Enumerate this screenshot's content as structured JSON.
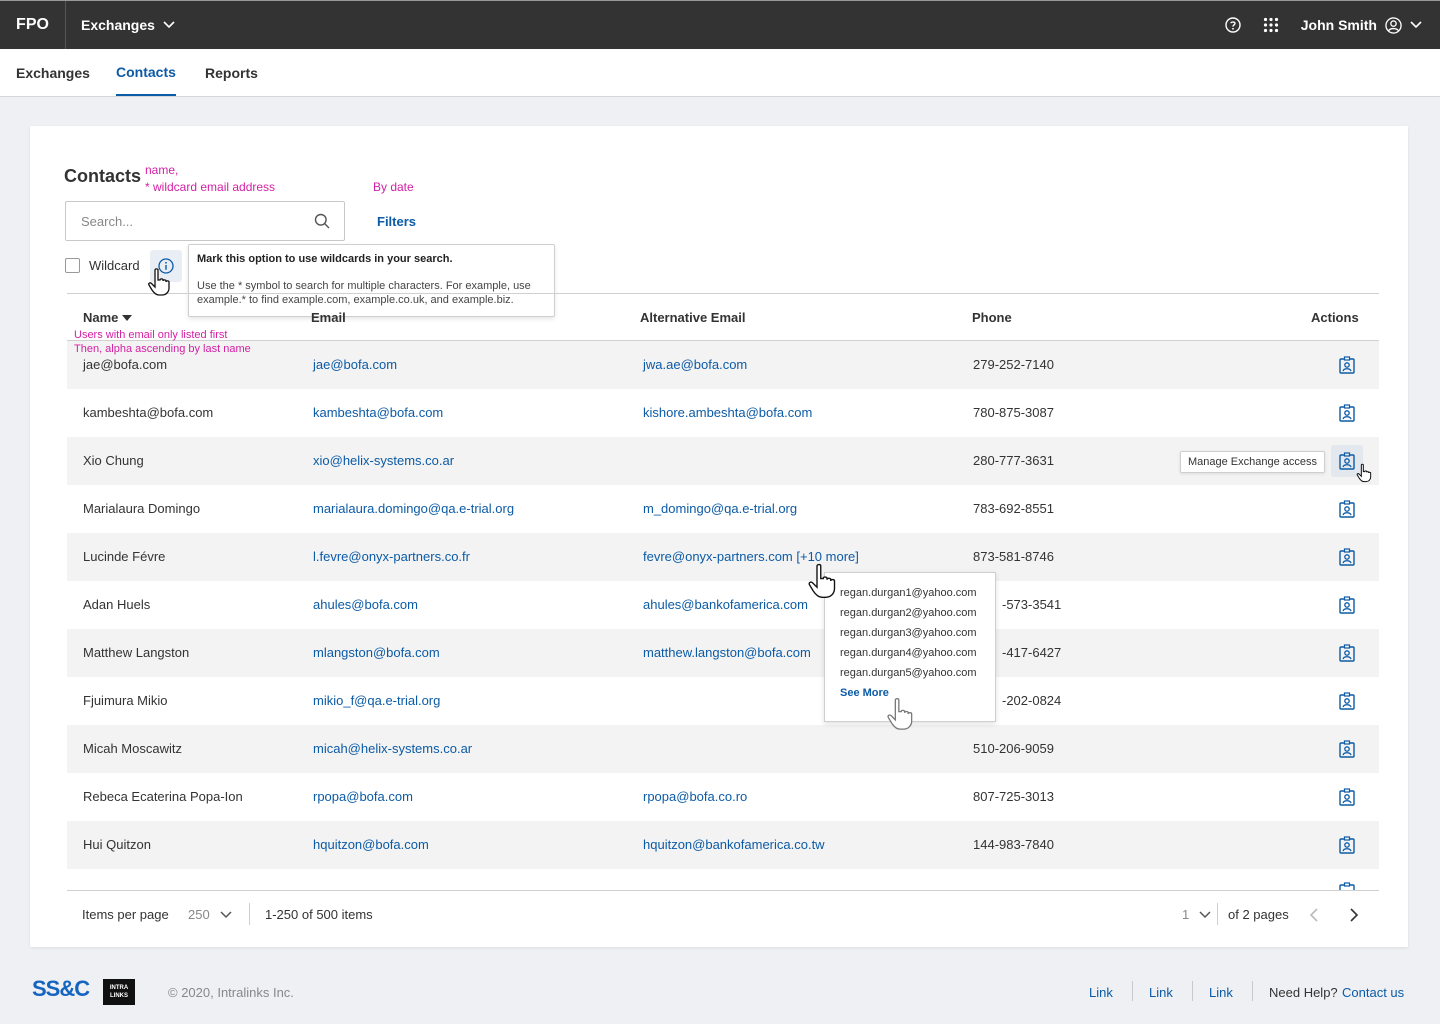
{
  "header": {
    "brand": "FPO",
    "app_selector": "Exchanges",
    "user_name": "John Smith",
    "icons": [
      "help-icon",
      "apps-grid-icon",
      "user-circle-icon",
      "chevron-down-icon"
    ]
  },
  "tabs": [
    {
      "label": "Exchanges",
      "active": false
    },
    {
      "label": "Contacts",
      "active": true
    },
    {
      "label": "Reports",
      "active": false
    }
  ],
  "contacts": {
    "title": "Contacts",
    "annotation_search_line1": "name,",
    "annotation_search_line2": "* wildcard email address",
    "annotation_filter": "By date",
    "search_placeholder": "Search...",
    "filters_label": "Filters",
    "wildcard_label": "Wildcard",
    "wildcard_checked": false,
    "tooltip_title": "Mark this option to use wildcards in your search.",
    "tooltip_body": "Use the * symbol to search for multiple characters. For example, use example.* to find example.com, example.co.uk, and example.biz.",
    "annotation_sort_line1": "Users with email only listed first",
    "annotation_sort_line2": "Then, alpha ascending by last name"
  },
  "table": {
    "columns": [
      "Name",
      "Email",
      "Alternative Email",
      "Phone",
      "Actions"
    ],
    "sorted_by": "Name",
    "action_tooltip": "Manage Exchange access",
    "rows": [
      {
        "name": "jae@bofa.com",
        "email": "jae@bofa.com",
        "alt": "jwa.ae@bofa.com",
        "phone": "279-252-7140"
      },
      {
        "name": "kambeshta@bofa.com",
        "email": "kambeshta@bofa.com",
        "alt": "kishore.ambeshta@bofa.com",
        "phone": "780-875-3087"
      },
      {
        "name": "Xio Chung",
        "email": "xio@helix-systems.co.ar",
        "alt": "",
        "phone": "280-777-3631"
      },
      {
        "name": "Marialaura Domingo",
        "email": "marialaura.domingo@qa.e-trial.org",
        "alt": "m_domingo@qa.e-trial.org",
        "phone": "783-692-8551"
      },
      {
        "name": "Lucinde Févre",
        "email": "l.fevre@onyx-partners.co.fr",
        "alt": "fevre@onyx-partners.com [+10 more]",
        "phone": "873-581-8746"
      },
      {
        "name": "Adan Huels",
        "email": "ahules@bofa.com",
        "alt": "ahules@bankofamerica.com",
        "phone": "-573-3541"
      },
      {
        "name": "Matthew Langston",
        "email": "mlangston@bofa.com",
        "alt": "matthew.langston@bofa.com",
        "phone": "-417-6427"
      },
      {
        "name": "Fjuimura Mikio",
        "email": "mikio_f@qa.e-trial.org",
        "alt": "",
        "phone": "-202-0824"
      },
      {
        "name": "Micah Moscawitz",
        "email": "micah@helix-systems.co.ar",
        "alt": "",
        "phone": "510-206-9059"
      },
      {
        "name": "Rebeca Ecaterina Popa-Ion",
        "email": "rpopa@bofa.com",
        "alt": "rpopa@bofa.co.ro",
        "phone": "807-725-3013"
      },
      {
        "name": "Hui Quitzon",
        "email": "hquitzon@bofa.com",
        "alt": "hquitzon@bankofamerica.co.tw",
        "phone": "144-983-7840"
      }
    ],
    "more_emails": [
      "regan.durgan1@yahoo.com",
      "regan.durgan2@yahoo.com",
      "regan.durgan3@yahoo.com",
      "regan.durgan4@yahoo.com",
      "regan.durgan5@yahoo.com"
    ],
    "see_more_label": "See More"
  },
  "pagination": {
    "items_per_page_label": "Items per page",
    "items_per_page": "250",
    "range": "1-250 of 500 items",
    "page": "1",
    "of_pages": "of 2 pages"
  },
  "footer": {
    "copyright": "© 2020, Intralinks Inc.",
    "logo_ssc": "SS&C",
    "logo_intralinks_line1": "INTRA",
    "logo_intralinks_line2": "LINKS",
    "links": [
      "Link",
      "Link",
      "Link"
    ],
    "help_text": "Need Help?",
    "contact_label": "Contact us"
  },
  "colors": {
    "topbar": "#333333",
    "accent": "#0c5ba6",
    "annotation": "#d31fa5",
    "row_alt": "#f3f3f3"
  }
}
